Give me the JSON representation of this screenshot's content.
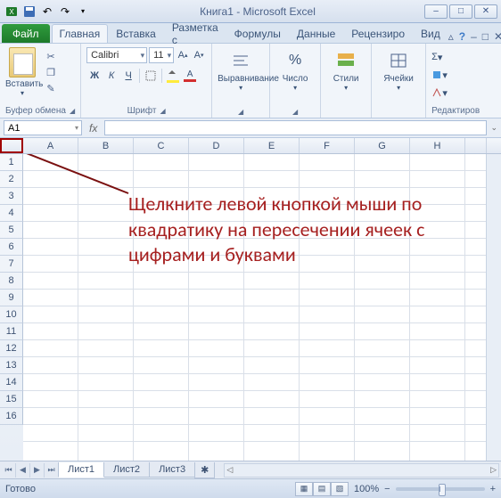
{
  "title": {
    "doc": "Книга1",
    "app": "Microsoft Excel"
  },
  "tabs": {
    "file": "Файл",
    "home": "Главная",
    "insert": "Вставка",
    "layout": "Разметка с",
    "formulas": "Формулы",
    "data": "Данные",
    "review": "Рецензиро",
    "view": "Вид"
  },
  "groups": {
    "clipboard": {
      "label": "Буфер обмена",
      "paste": "Вставить"
    },
    "font": {
      "label": "Шрифт",
      "name": "Calibri",
      "size": "11"
    },
    "alignment": {
      "label": "Выравнивание"
    },
    "number": {
      "label": "Число"
    },
    "styles": {
      "label": "Стили"
    },
    "cells": {
      "label": "Ячейки"
    },
    "editing": {
      "label": "Редактиров"
    }
  },
  "name_box": "A1",
  "fx_label": "fx",
  "columns": [
    "A",
    "B",
    "C",
    "D",
    "E",
    "F",
    "G",
    "H"
  ],
  "rows": [
    "1",
    "2",
    "3",
    "4",
    "5",
    "6",
    "7",
    "8",
    "9",
    "10",
    "11",
    "12",
    "13",
    "14",
    "15",
    "16"
  ],
  "annotation": "Щелкните левой кнопкой мыши по квадратику на пересечении ячеек с цифрами и буквами",
  "sheets": {
    "s1": "Лист1",
    "s2": "Лист2",
    "s3": "Лист3"
  },
  "status": {
    "ready": "Готово",
    "zoom": "100%"
  },
  "glyphs": {
    "minus": "–",
    "square": "□",
    "close": "✕",
    "dropdown": "▾",
    "help": "?",
    "sigma": "Σ",
    "percent": "%",
    "bold": "Ж",
    "italic": "К",
    "underline": "Ч",
    "cut": "✂",
    "copy": "❐",
    "brush": "✎",
    "plus": "+",
    "minus2": "−",
    "first": "⏮",
    "prev": "◀",
    "next": "▶",
    "last": "⏭",
    "left": "◁",
    "right": "▷"
  }
}
